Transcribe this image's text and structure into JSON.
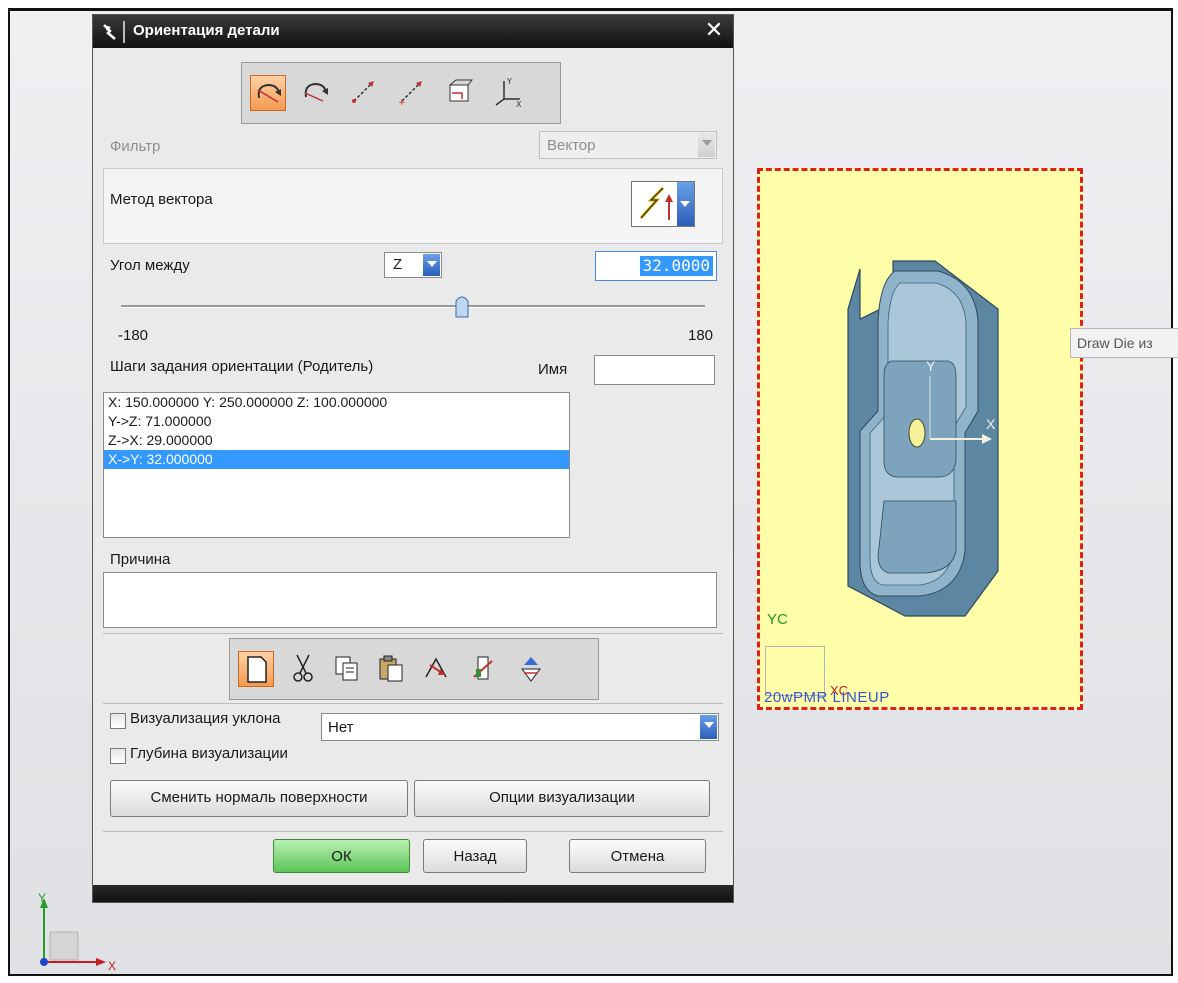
{
  "dialog": {
    "title": "Ориентация детали",
    "filter_label": "Фильтр",
    "filter_value": "Вектор",
    "vector_method_label": "Метод вектора",
    "angle_label": "Угол между",
    "axis_value": "Z",
    "angle_value": "32.0000",
    "angle_fraction": 0.589,
    "slider_min": "-180",
    "slider_max": "180",
    "steps_label": "Шаги задания ориентации (Родитель)",
    "name_label": "Имя",
    "name_value": "",
    "steps": [
      "X: 150.000000 Y: 250.000000 Z: 100.000000",
      "Y->Z: 71.000000",
      "Z->X: 29.000000",
      "X->Y: 32.000000"
    ],
    "selected_step_index": 3,
    "reason_label": "Причина",
    "reason_value": "",
    "draft_viz_label": "Визуализация уклона",
    "draft_viz_value": "Нет",
    "depth_viz_label": "Глубина визуализации",
    "change_normal_button": "Сменить нормаль поверхности",
    "viz_options_button": "Опции визуализации",
    "ok_button": "ОК",
    "back_button": "Назад",
    "cancel_button": "Отмена"
  },
  "toolbar_top": [
    "rotate-dynamic-icon",
    "rotate-icon",
    "vector-icon",
    "point-vector-icon",
    "face-icon",
    "csys-icon"
  ],
  "toolbar_bottom": [
    "new-icon",
    "cut-icon",
    "copy-icon",
    "paste-icon",
    "move-up-icon",
    "move-down-icon",
    "refresh-icon"
  ],
  "viewport": {
    "tooltip": "Draw Die из",
    "wcs_label": "YC",
    "wcs_label_x": "XC",
    "overlay_text": "20wPMR LINEUP",
    "part_axis_y": "Y",
    "part_axis_x": "X",
    "triad_y": "Y",
    "triad_x": "X"
  },
  "colors": {
    "accent": "#3399ff",
    "active_icon": "#f59a50",
    "ok_button": "#5cc458",
    "model_fill": "#ffffa9",
    "model_border": "#e02020",
    "part": "#6f97b0"
  }
}
